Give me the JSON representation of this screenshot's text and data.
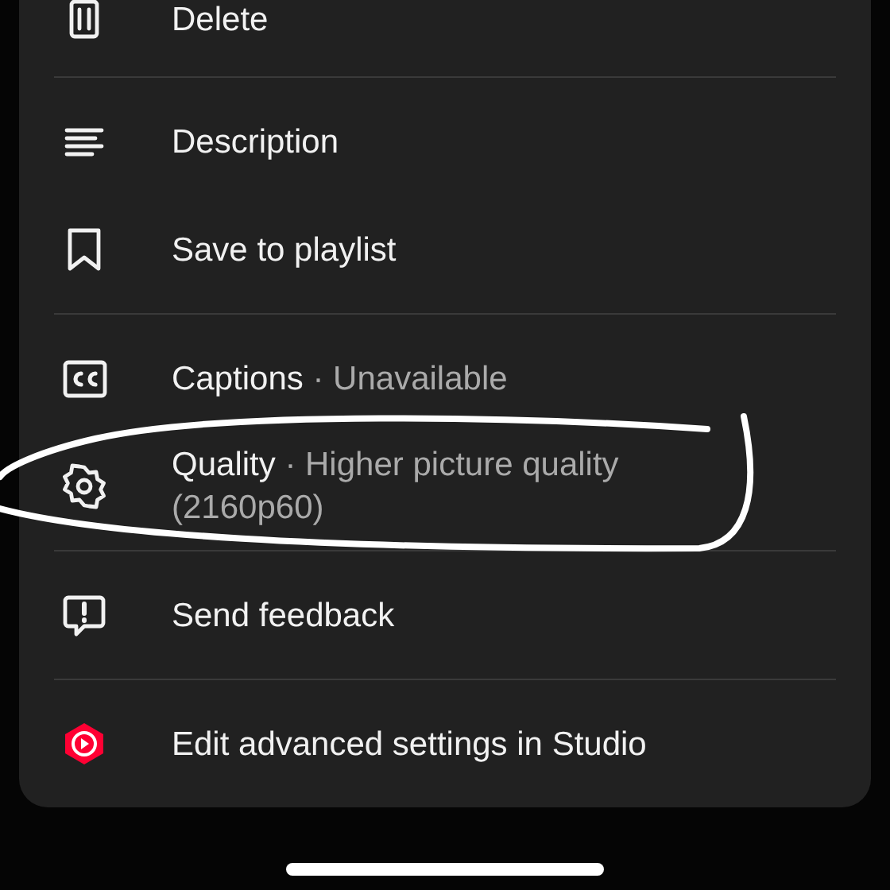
{
  "menu": {
    "groups": [
      {
        "items": [
          {
            "kind": "trash",
            "label": "Delete"
          }
        ]
      },
      {
        "items": [
          {
            "kind": "lines",
            "label": "Description"
          },
          {
            "kind": "bookmark",
            "label": "Save to playlist"
          }
        ]
      },
      {
        "items": [
          {
            "kind": "captions",
            "label": "Captions",
            "separator": "·",
            "detail": "Unavailable"
          },
          {
            "kind": "gear",
            "label": "Quality",
            "separator": "·",
            "detail": "Higher picture quality (2160p60)"
          }
        ]
      },
      {
        "items": [
          {
            "kind": "feedback",
            "label": "Send feedback"
          }
        ]
      },
      {
        "items": [
          {
            "kind": "studio",
            "label": "Edit advanced settings in Studio"
          }
        ]
      }
    ]
  }
}
